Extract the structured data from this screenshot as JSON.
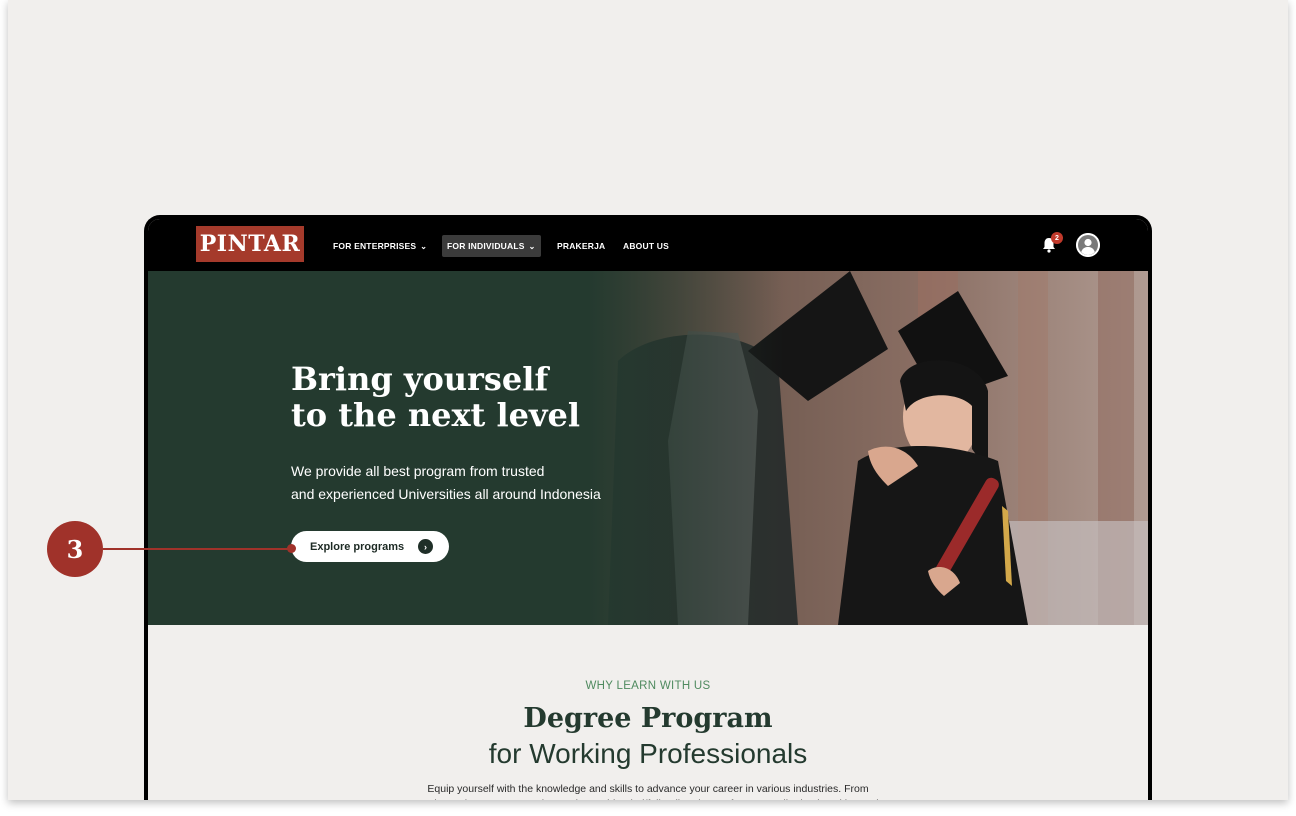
{
  "nav": {
    "logo": "PINTAR",
    "items": [
      {
        "label": "FOR ENTERPRISES",
        "has_dropdown": true,
        "active": false
      },
      {
        "label": "FOR INDIVIDUALS",
        "has_dropdown": true,
        "active": true
      },
      {
        "label": "PRAKERJA",
        "has_dropdown": false,
        "active": false
      },
      {
        "label": "ABOUT US",
        "has_dropdown": false,
        "active": false
      }
    ],
    "notification_count": "2",
    "chevron": "⌄"
  },
  "hero": {
    "title_line1": "Bring yourself",
    "title_line2": "to the next level",
    "subtitle_line1": "We provide all best program from trusted",
    "subtitle_line2": "and experienced Universities all around Indonesia",
    "cta_label": "Explore programs",
    "cta_icon": "›"
  },
  "section": {
    "eyebrow": "WHY LEARN WITH US",
    "title": "Degree Program",
    "subtitle": "for Working Professionals",
    "body": "Equip yourself with the knowledge and skills to advance your career in various industries. From Undergraduate to Postgraduate, choose blended/full online degree from accredited universities and"
  },
  "callout": {
    "number": "3"
  },
  "colors": {
    "brand_red": "#a53a2b",
    "hero_green": "#243a2f",
    "eyebrow_green": "#4f8a5f",
    "callout_red": "#a0322a"
  }
}
